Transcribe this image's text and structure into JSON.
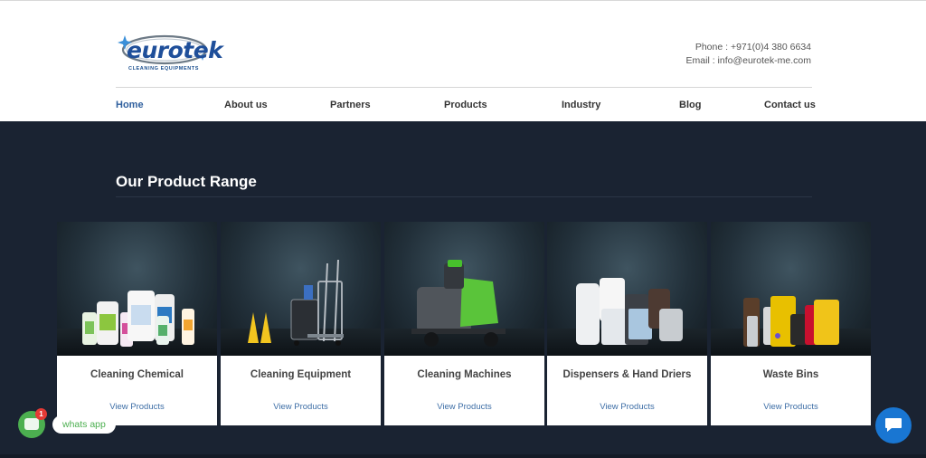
{
  "header": {
    "logo": {
      "wordmark": "eurotek",
      "tagline": "CLEANING EQUIPMENTS",
      "icon": "sparkle-icon"
    },
    "phone": "Phone : +971(0)4 380 6634",
    "email": "Email : info@eurotek-me.com"
  },
  "nav": {
    "items": [
      {
        "label": "Home",
        "active": true
      },
      {
        "label": "About us",
        "active": false
      },
      {
        "label": "Partners",
        "active": false
      },
      {
        "label": "Products",
        "active": false
      },
      {
        "label": "Industry",
        "active": false
      },
      {
        "label": "Blog",
        "active": false
      },
      {
        "label": "Contact us",
        "active": false
      }
    ]
  },
  "section": {
    "title": "Our Product Range"
  },
  "products": [
    {
      "name": "Cleaning Chemical",
      "link": "View Products",
      "image": "cleaning-chemical-bottles"
    },
    {
      "name": "Cleaning Equipment",
      "link": "View Products",
      "image": "cleaning-trolley-and-signs"
    },
    {
      "name": "Cleaning Machines",
      "link": "View Products",
      "image": "floor-sweeper-machine"
    },
    {
      "name": "Dispensers & Hand Driers",
      "link": "View Products",
      "image": "dispensers-and-hand-driers"
    },
    {
      "name": "Waste Bins",
      "link": "View Products",
      "image": "waste-bins"
    }
  ],
  "whatsapp": {
    "label": "whats app",
    "badge": "1",
    "icon": "chat-bubble-icon"
  },
  "chat": {
    "icon": "message-icon"
  },
  "colors": {
    "dark_background": "#1a2332",
    "nav_active": "#2f5f9e",
    "link": "#3d6ea6",
    "whatsapp_green": "#4caf50",
    "badge_red": "#e53935",
    "chat_blue": "#1976d2"
  }
}
